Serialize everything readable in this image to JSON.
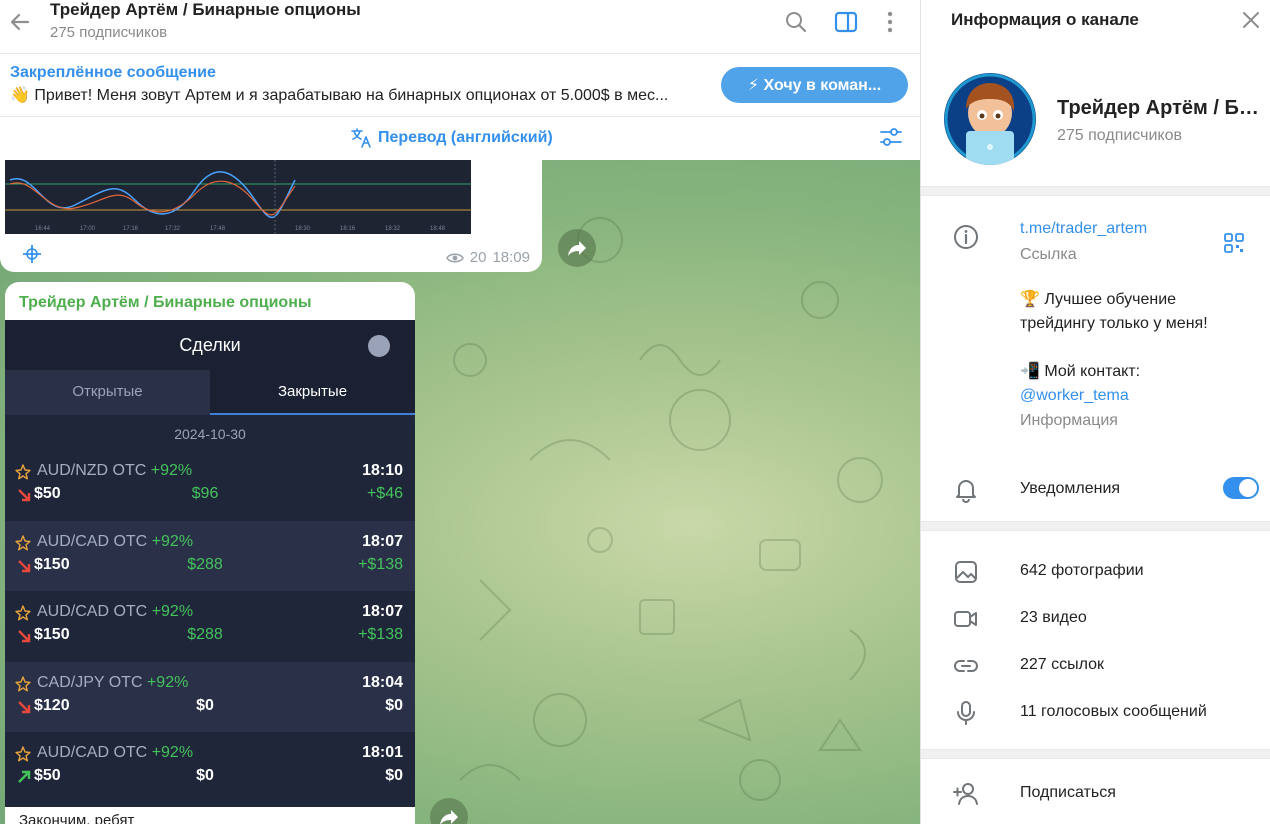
{
  "header": {
    "title": "Трейдер Артём / Бинарные опционы",
    "subtitle": "275 подписчиков"
  },
  "pinned": {
    "title": "Закреплённое сообщение",
    "text": "👋 Привет! Меня зовут Артем и я зарабатываю на бинарных опционах от 5.000$ в мес...",
    "button_label": "⚡ Хочу в коман..."
  },
  "translate": {
    "label": "Перевод (английский)"
  },
  "message1": {
    "views": "20",
    "time": "18:09"
  },
  "message2": {
    "sender": "Трейдер Артём / Бинарные опционы",
    "trades_title": "Сделки",
    "tab_open": "Открытые",
    "tab_closed": "Закрытые",
    "date": "2024-10-30",
    "trades": [
      {
        "pair": "AUD/NZD OTC",
        "pct": "+92%",
        "time": "18:10",
        "amount": "$50",
        "payout": "$96",
        "profit": "+$46",
        "direction": "down"
      },
      {
        "pair": "AUD/CAD OTC",
        "pct": "+92%",
        "time": "18:07",
        "amount": "$150",
        "payout": "$288",
        "profit": "+$138",
        "direction": "down"
      },
      {
        "pair": "AUD/CAD OTC",
        "pct": "+92%",
        "time": "18:07",
        "amount": "$150",
        "payout": "$288",
        "profit": "+$138",
        "direction": "down"
      },
      {
        "pair": "CAD/JPY OTC",
        "pct": "+92%",
        "time": "18:04",
        "amount": "$120",
        "payout": "$0",
        "profit": "$0",
        "direction": "down"
      },
      {
        "pair": "AUD/CAD OTC",
        "pct": "+92%",
        "time": "18:01",
        "amount": "$50",
        "payout": "$0",
        "profit": "$0",
        "direction": "up"
      }
    ],
    "caption": "Закончим, ребят"
  },
  "info": {
    "title": "Информация о канале",
    "name": "Трейдер Артём / Бинарные опционы",
    "subscribers": "275 подписчиков",
    "link": "t.me/trader_artem",
    "link_label": "Ссылка",
    "description_line1": "🏆 Лучшее обучение",
    "description_line2": "трейдингу только у меня!",
    "description_line3": "📲 Мой контакт:",
    "contact": "@worker_tema",
    "description_label": "Информация",
    "notifications": "Уведомления",
    "notifications_on": true,
    "media": {
      "photos": "642 фотографии",
      "videos": "23 видео",
      "links": "227 ссылок",
      "voice": "11 голосовых сообщений"
    },
    "subscribe": "Подписаться"
  },
  "colors": {
    "accent": "#3390ec",
    "sender_green": "#4fae4e",
    "profit_green": "#43c35b"
  }
}
